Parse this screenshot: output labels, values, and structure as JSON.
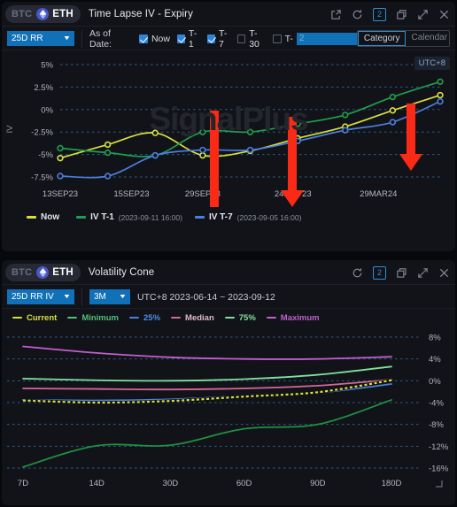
{
  "panel_top": {
    "pair": {
      "btc": "BTC",
      "eth": "ETH",
      "eth_icon": "ethereum-icon"
    },
    "title": "Time Lapse IV - Expiry",
    "icons": [
      "external-link-icon",
      "refresh-icon",
      "count-badge",
      "copy-icon",
      "expand-icon",
      "close-icon"
    ],
    "badge_count": "2",
    "controls": {
      "metric_select": "25D RR",
      "as_of_label": "As of Date:",
      "checkboxes": [
        {
          "label": "Now",
          "checked": true
        },
        {
          "label": "T-1",
          "checked": true
        },
        {
          "label": "T-7",
          "checked": true
        },
        {
          "label": "T-30",
          "checked": false
        }
      ],
      "t_custom_label": "T-",
      "t_custom_value": "2",
      "toggle": {
        "active": "Category",
        "inactive": "Calendar"
      }
    },
    "watermark": "SignalPlus",
    "timezone_badge": "UTC+8",
    "legend": [
      {
        "name": "Now",
        "sub": "",
        "color": "#d8e041"
      },
      {
        "name": "IV T-1",
        "sub": "(2023-09-11 16:00)",
        "color": "#1f9d4e"
      },
      {
        "name": "IV T-7",
        "sub": "(2023-09-05 16:00)",
        "color": "#4a7fe0"
      }
    ],
    "annotations": [
      {
        "name": "red-arrow-1"
      },
      {
        "name": "red-arrow-2"
      },
      {
        "name": "red-arrow-3"
      }
    ]
  },
  "panel_bottom": {
    "pair": {
      "btc": "BTC",
      "eth": "ETH",
      "eth_icon": "ethereum-icon"
    },
    "title": "Volatility Cone",
    "badge_count": "2",
    "controls": {
      "metric_select": "25D RR IV",
      "period_select": "3M",
      "date_range": "UTC+8 2023-06-14 ~ 2023-09-12"
    },
    "legend": [
      {
        "name": "Current",
        "color": "#d8e041"
      },
      {
        "name": "Minimum",
        "color": "#4fbf7a"
      },
      {
        "name": "25%",
        "color": "#4a7fe0"
      },
      {
        "name": "Median",
        "color": "#d4679a"
      },
      {
        "name": "75%",
        "color": "#7fe0a0"
      },
      {
        "name": "Maximum",
        "color": "#c05fd0"
      }
    ]
  },
  "chart_data": [
    {
      "type": "line",
      "title": "Time Lapse IV - Expiry",
      "xlabel": "",
      "ylabel": "IV",
      "categories": [
        "13SEP23",
        "15SEP23",
        "29SEP23",
        "24NOV23",
        "29MAR24"
      ],
      "x_positions": [
        0,
        1,
        2,
        3,
        4,
        5,
        6,
        7,
        8
      ],
      "ytick_labels": [
        "5%",
        "2.5%",
        "0%",
        "-2.5%",
        "-5%",
        "-7.5%"
      ],
      "ylim": [
        -7.5,
        5
      ],
      "grid": true,
      "legend_position": "bottom",
      "series": [
        {
          "name": "Now",
          "color": "#d8e041",
          "values": [
            -5.4,
            -3.9,
            -2.6,
            -5.1,
            -4.6,
            -3.2,
            -1.9,
            -0.1,
            1.6
          ]
        },
        {
          "name": "IV T-1 (2023-09-11 16:00)",
          "color": "#1f9d4e",
          "values": [
            -4.3,
            -4.8,
            -5.1,
            -2.5,
            -2.5,
            -1.6,
            -0.6,
            1.4,
            3.1
          ]
        },
        {
          "name": "IV T-7 (2023-09-05 16:00)",
          "color": "#4a7fe0",
          "values": [
            -7.4,
            -7.4,
            -5.1,
            -4.5,
            -4.5,
            -3.5,
            -2.3,
            -1.4,
            0.9
          ]
        }
      ]
    },
    {
      "type": "line",
      "title": "Volatility Cone",
      "xlabel": "",
      "ylabel": "",
      "categories": [
        "7D",
        "14D",
        "30D",
        "60D",
        "90D",
        "180D"
      ],
      "ytick_labels": [
        "8%",
        "4%",
        "0%",
        "-4%",
        "-8%",
        "-12%",
        "-16%"
      ],
      "ylim": [
        -16,
        8
      ],
      "grid": true,
      "legend_position": "top",
      "series": [
        {
          "name": "Maximum",
          "color": "#c05fd0",
          "values": [
            6.3,
            5.1,
            4.3,
            4.0,
            4.0,
            4.4
          ]
        },
        {
          "name": "75%",
          "color": "#7fe0a0",
          "values": [
            0.4,
            0.1,
            0.0,
            0.3,
            1.1,
            2.6
          ]
        },
        {
          "name": "Median",
          "color": "#d4679a",
          "values": [
            -1.4,
            -1.5,
            -1.6,
            -1.4,
            -0.9,
            0.2
          ]
        },
        {
          "name": "25%",
          "color": "#4a7fe0",
          "values": [
            -3.5,
            -3.6,
            -3.4,
            -2.8,
            -2.2,
            -0.6
          ]
        },
        {
          "name": "Current",
          "color": "#d8e041",
          "values": [
            -3.6,
            -4.0,
            -3.7,
            -2.9,
            -2.1,
            0.1
          ]
        },
        {
          "name": "Minimum",
          "color": "#1f8f43",
          "values": [
            -15.8,
            -11.9,
            -11.8,
            -8.8,
            -8.0,
            -3.5
          ]
        }
      ]
    }
  ]
}
